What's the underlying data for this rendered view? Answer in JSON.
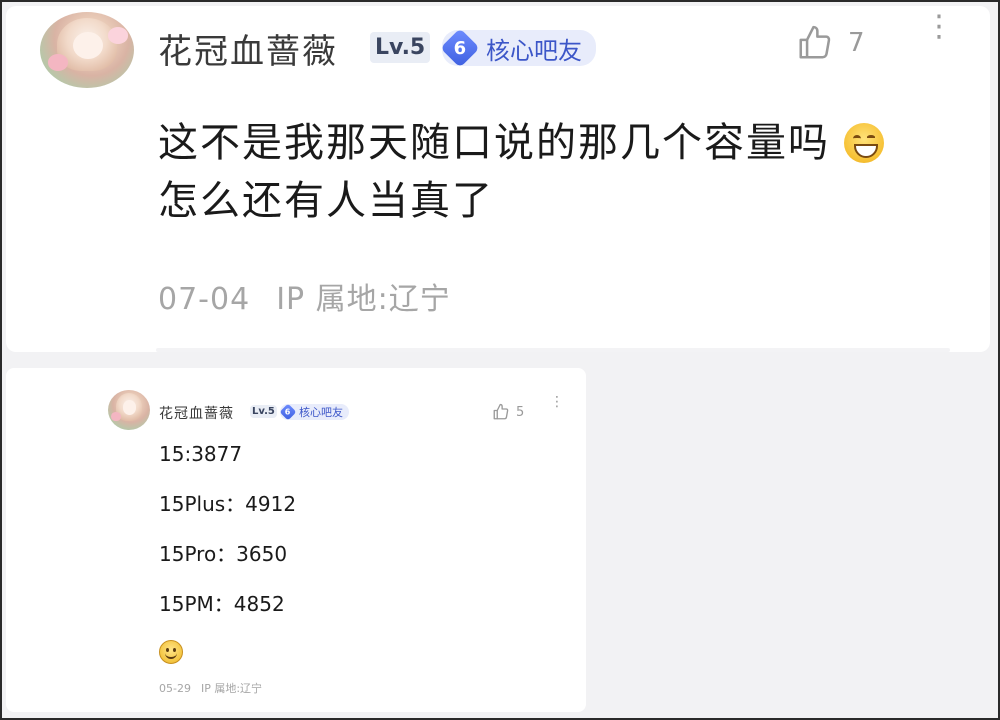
{
  "main_post": {
    "username": "花冠血蔷薇",
    "level": "Lv.5",
    "fan_badge": {
      "number": "6",
      "label": "核心吧友"
    },
    "like_count": "7",
    "more_glyph": "⋮",
    "content_lines": [
      "这不是我那天随口说的那几个容量吗",
      "怎么还有人当真了"
    ],
    "emoji": "laughing-face-emoji",
    "date": "07-04",
    "ip_location": "IP 属地:辽宁"
  },
  "quoted_post": {
    "username": "花冠血蔷薇",
    "level": "Lv.5",
    "fan_badge": {
      "number": "6",
      "label": "核心吧友"
    },
    "like_count": "5",
    "more_glyph": "⋮",
    "content_lines": [
      "15:3877",
      "15Plus：4912",
      "15Pro：3650",
      "15PM：4852"
    ],
    "emoji": "smiling-face-emoji",
    "date": "05-29",
    "ip_location": "IP 属地:辽宁"
  },
  "colors": {
    "background": "#f2f2f4",
    "card": "#ffffff",
    "badge_blue": "#3c56c8",
    "meta_gray": "#a6a6a6"
  }
}
